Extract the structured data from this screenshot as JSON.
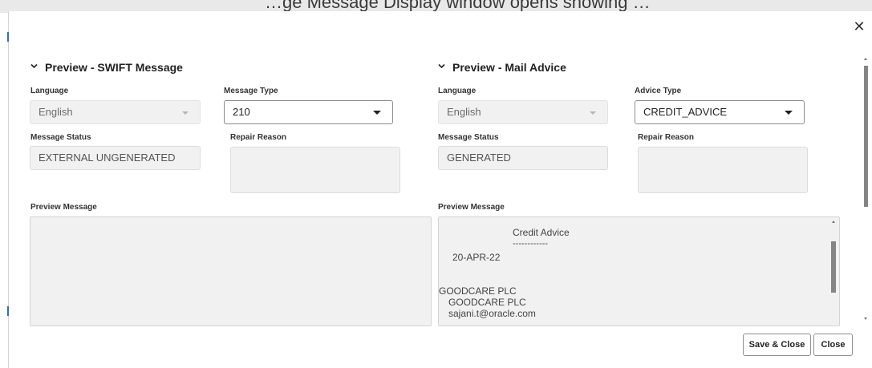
{
  "background": {
    "header_text": "…ge Message Display window opens showing …"
  },
  "dialog": {
    "close_icon": "close-icon",
    "swift": {
      "title": "Preview - SWIFT Message",
      "language_label": "Language",
      "language_value": "English",
      "message_type_label": "Message Type",
      "message_type_value": "210",
      "message_status_label": "Message Status",
      "message_status_value": "EXTERNAL UNGENERATED",
      "repair_reason_label": "Repair Reason",
      "repair_reason_value": "",
      "preview_label": "Preview Message",
      "preview_text": ""
    },
    "mail": {
      "title": "Preview - Mail Advice",
      "language_label": "Language",
      "language_value": "English",
      "advice_type_label": "Advice Type",
      "advice_type_value": "CREDIT_ADVICE",
      "message_status_label": "Message Status",
      "message_status_value": "GENERATED",
      "repair_reason_label": "Repair Reason",
      "repair_reason_value": "",
      "preview_label": "Preview Message",
      "preview_lines": {
        "title": "Credit Advice",
        "underline": "------------",
        "date": "20-APR-22",
        "company": "GOODCARE PLC",
        "company2": "GOODCARE PLC",
        "email": "sajani.t@oracle.com"
      }
    },
    "buttons": {
      "save_close": "Save & Close",
      "close": "Close"
    }
  },
  "colors": {
    "panel_bg": "#f1f1f1",
    "border": "#8c8c8c",
    "scroll_thumb": "#858585"
  }
}
